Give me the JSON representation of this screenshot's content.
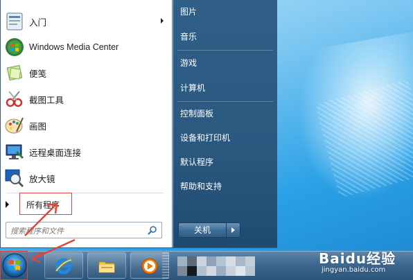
{
  "programs": [
    {
      "label": "入门",
      "has_submenu": true,
      "icon": "getting-started-icon"
    },
    {
      "label": "Windows Media Center",
      "has_submenu": false,
      "icon": "windows-media-center-icon"
    },
    {
      "label": "便笺",
      "has_submenu": false,
      "icon": "sticky-notes-icon"
    },
    {
      "label": "截图工具",
      "has_submenu": false,
      "icon": "snipping-tool-icon"
    },
    {
      "label": "画图",
      "has_submenu": false,
      "icon": "paint-icon"
    },
    {
      "label": "远程桌面连接",
      "has_submenu": false,
      "icon": "remote-desktop-icon"
    },
    {
      "label": "放大镜",
      "has_submenu": false,
      "icon": "magnifier-icon"
    }
  ],
  "all_programs_label": "所有程序",
  "search": {
    "placeholder": "搜索程序和文件"
  },
  "right_items": {
    "pictures": "图片",
    "music": "音乐",
    "games": "游戏",
    "computer": "计算机",
    "control_panel": "控制面板",
    "devices_printers": "设备和打印机",
    "default_programs": "默认程序",
    "help_support": "帮助和支持"
  },
  "shutdown_label": "关机",
  "taskbar": {
    "items": [
      "internet-explorer-icon",
      "file-explorer-icon",
      "media-player-icon"
    ]
  },
  "watermark": {
    "logo": "Baidu经验",
    "url": "jingyan.baidu.com"
  },
  "colors": {
    "right_pane": "#2f5a80",
    "callout": "#e0443a",
    "taskbar": "#3f6a92"
  }
}
